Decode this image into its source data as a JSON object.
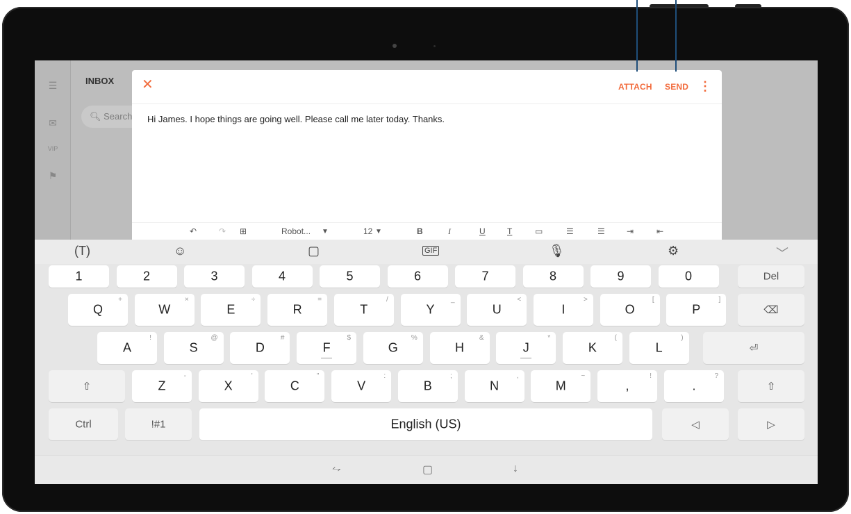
{
  "mail": {
    "inbox_title": "INBOX",
    "search_placeholder": "Search",
    "rail": {
      "menu_icon": "menu-icon",
      "mail_icon": "mail-icon",
      "vip_label": "VIP",
      "flag_icon": "flag-icon"
    }
  },
  "compose": {
    "close_icon": "close-icon",
    "attach_label": "ATTACH",
    "send_label": "SEND",
    "more_icon": "more-vertical-icon",
    "body": "Hi James. I hope things are going well. Please call me later today. Thanks."
  },
  "format_bar": {
    "undo_icon": "undo-icon",
    "redo_icon": "redo-icon",
    "image_icon": "insert-image-icon",
    "font_name": "Robot...",
    "font_size": "12",
    "bold": "B",
    "italic": "I",
    "underline": "U",
    "text_color": "T",
    "bg_color": "background-color-icon",
    "bullets": "bulleted-list-icon",
    "numbers": "numbered-list-icon",
    "indent": "indent-icon",
    "outdent": "outdent-icon"
  },
  "keyboard_toolbar": {
    "icons": [
      "translate-icon",
      "emoji-icon",
      "sticker-icon",
      "gif-icon",
      "microphone-icon",
      "settings-icon",
      "collapse-keyboard-icon"
    ]
  },
  "keyboard": {
    "number_row": [
      "1",
      "2",
      "3",
      "4",
      "5",
      "6",
      "7",
      "8",
      "9",
      "0"
    ],
    "del_label": "Del",
    "row_q": [
      {
        "k": "Q",
        "s": "+"
      },
      {
        "k": "W",
        "s": "×"
      },
      {
        "k": "E",
        "s": "÷"
      },
      {
        "k": "R",
        "s": "="
      },
      {
        "k": "T",
        "s": "/"
      },
      {
        "k": "Y",
        "s": "_"
      },
      {
        "k": "U",
        "s": "<"
      },
      {
        "k": "I",
        "s": ">"
      },
      {
        "k": "O",
        "s": "["
      },
      {
        "k": "P",
        "s": "]"
      }
    ],
    "row_a": [
      {
        "k": "A",
        "s": "!"
      },
      {
        "k": "S",
        "s": "@"
      },
      {
        "k": "D",
        "s": "#"
      },
      {
        "k": "F",
        "s": "$"
      },
      {
        "k": "G",
        "s": "%"
      },
      {
        "k": "H",
        "s": "&"
      },
      {
        "k": "J",
        "s": "*"
      },
      {
        "k": "K",
        "s": "("
      },
      {
        "k": "L",
        "s": ")"
      }
    ],
    "row_z": [
      {
        "k": "Z",
        "s": "-"
      },
      {
        "k": "X",
        "s": "'"
      },
      {
        "k": "C",
        "s": "\""
      },
      {
        "k": "V",
        "s": ":"
      },
      {
        "k": "B",
        "s": ";"
      },
      {
        "k": "N",
        "s": ","
      },
      {
        "k": "M",
        "s": "~"
      }
    ],
    "comma_key": ",",
    "comma_alt": "!",
    "period_key": ".",
    "period_alt": "?",
    "ctrl_label": "Ctrl",
    "symbols_label": "!#1",
    "space_label": "English (US)",
    "backspace_icon": "backspace-icon",
    "enter_icon": "enter-icon",
    "shift_icon": "shift-icon",
    "left_arrow_icon": "cursor-left-icon",
    "right_arrow_icon": "cursor-right-icon"
  },
  "navbar": {
    "icons": [
      "recents-icon",
      "home-icon",
      "back-icon"
    ]
  },
  "colors": {
    "accent": "#f26b3c",
    "callout": "#1f4e7a"
  }
}
